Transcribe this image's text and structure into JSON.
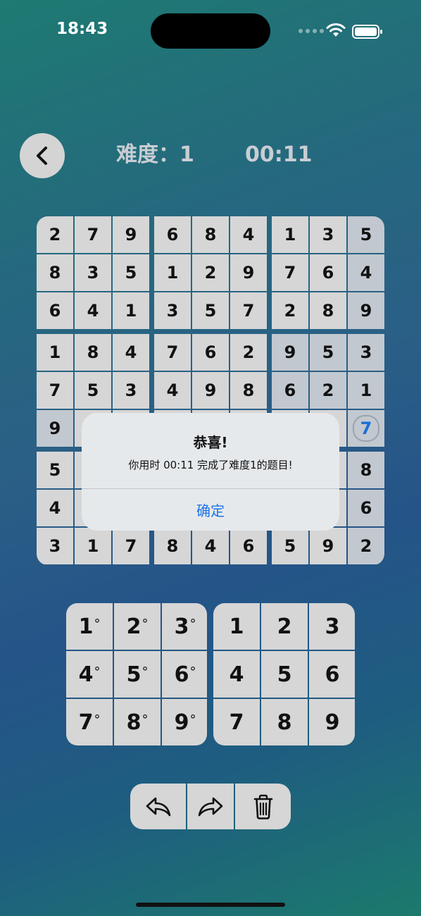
{
  "status_bar": {
    "time": "18:43",
    "wifi_icon": "wifi-icon",
    "battery_icon": "battery-icon"
  },
  "header": {
    "back_icon": "chevron-left-icon",
    "difficulty": "难度：1",
    "timer": "00:11"
  },
  "board": {
    "rows": [
      [
        "2",
        "7",
        "9",
        "6",
        "8",
        "4",
        "1",
        "3",
        "5"
      ],
      [
        "8",
        "3",
        "5",
        "1",
        "2",
        "9",
        "7",
        "6",
        "4"
      ],
      [
        "6",
        "4",
        "1",
        "3",
        "5",
        "7",
        "2",
        "8",
        "9"
      ],
      [
        "1",
        "8",
        "4",
        "7",
        "6",
        "2",
        "9",
        "5",
        "3"
      ],
      [
        "7",
        "5",
        "3",
        "4",
        "9",
        "8",
        "6",
        "2",
        "1"
      ],
      [
        "9",
        "",
        "",
        "",
        "",
        "",
        "",
        "",
        "7"
      ],
      [
        "5",
        "",
        "",
        "",
        "",
        "",
        "",
        "",
        "8"
      ],
      [
        "4",
        "",
        "",
        "",
        "",
        "",
        "",
        "",
        "6"
      ],
      [
        "3",
        "1",
        "7",
        "8",
        "4",
        "6",
        "5",
        "9",
        "2"
      ]
    ],
    "selected_value": "7"
  },
  "dialog": {
    "title": "恭喜!",
    "message": "你用时 00:11 完成了难度1的题目!",
    "ok_label": "确定"
  },
  "numpad": {
    "note_keys": [
      "1",
      "2",
      "3",
      "4",
      "5",
      "6",
      "7",
      "8",
      "9"
    ],
    "note_mark": "°",
    "value_keys": [
      "1",
      "2",
      "3",
      "4",
      "5",
      "6",
      "7",
      "8",
      "9"
    ]
  },
  "toolbar": {
    "undo_icon": "undo-icon",
    "redo_icon": "redo-icon",
    "delete_icon": "trash-icon"
  }
}
